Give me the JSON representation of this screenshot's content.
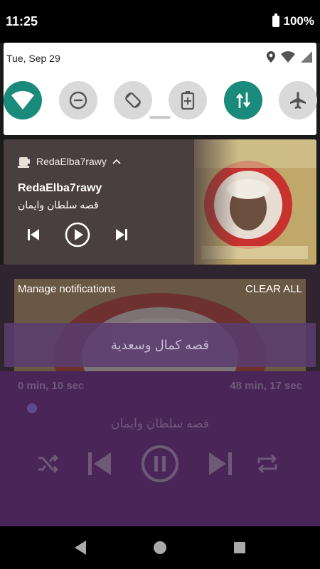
{
  "status_bar": {
    "time": "11:25",
    "battery": "100%"
  },
  "quick_settings": {
    "date": "Tue, Sep 29"
  },
  "notification": {
    "app_name": "RedaElba7rawy",
    "title": "RedaElba7rawy",
    "subtitle": "قصه سلطان وايمان"
  },
  "shade_actions": {
    "manage": "Manage notifications",
    "clear_all": "CLEAR ALL"
  },
  "player": {
    "banner_track": "قصه كمال وسعدية",
    "elapsed": "0 min, 10 sec",
    "duration": "48 min, 17 sec",
    "current_track": "قصه سلطان وايمان"
  },
  "colors": {
    "accent_teal": "#1a8a7a",
    "player_bg": "#4a2557",
    "media_card": "#4a3f40"
  }
}
